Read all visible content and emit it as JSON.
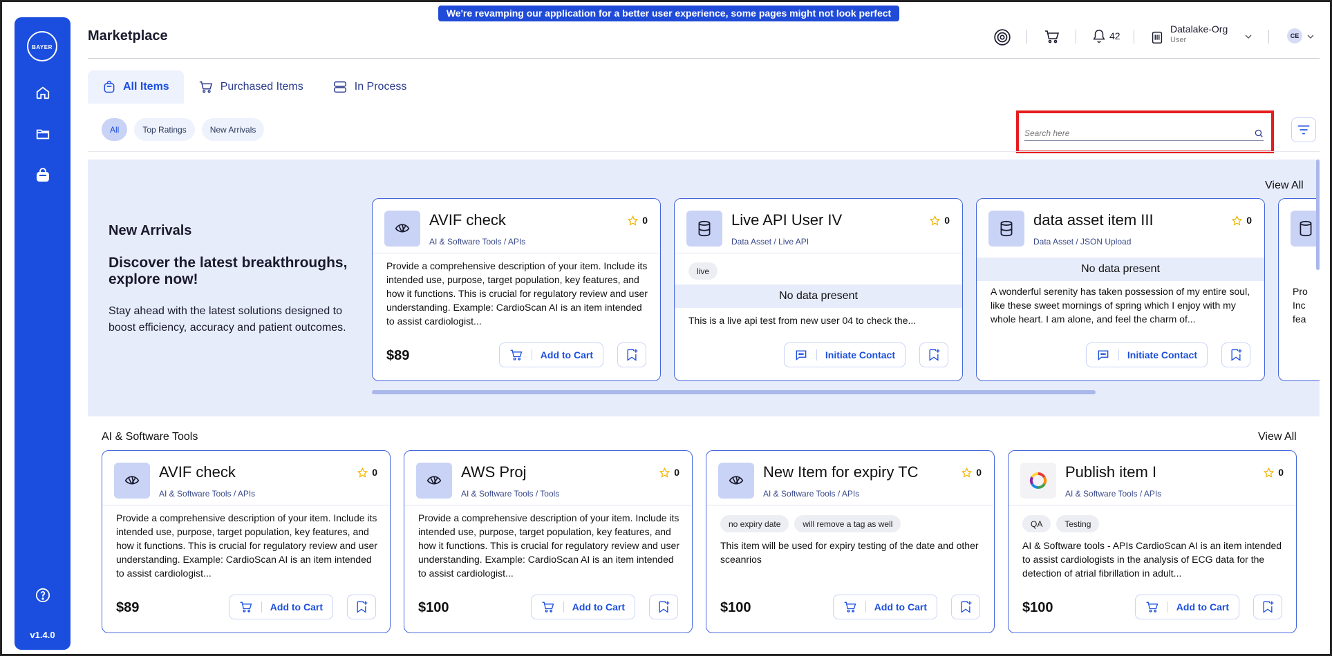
{
  "banner": "We're revamping our application for a better user experience, some pages might not look perfect yet!",
  "app": {
    "version": "v1.4.0",
    "logo_text_h": "BAYER",
    "logo_text_v": "BAYER"
  },
  "header": {
    "title": "Marketplace",
    "notification_count": "42",
    "org_name": "Datalake-Org",
    "org_role": "User",
    "avatar_initials": "CE"
  },
  "tabs": [
    {
      "label": "All Items",
      "icon": "bag-icon"
    },
    {
      "label": "Purchased Items",
      "icon": "cart-icon"
    },
    {
      "label": "In Process",
      "icon": "layers-icon"
    }
  ],
  "filters": [
    "All",
    "Top Ratings",
    "New Arrivals"
  ],
  "search": {
    "placeholder": "Search here"
  },
  "arrivals": {
    "heading": "New Arrivals",
    "subheading": "Discover the latest breakthroughs, explore now!",
    "description": "Stay ahead with the latest solutions designed to boost efficiency, accuracy and patient outcomes.",
    "view_all": "View All",
    "cards": [
      {
        "title": "AVIF check",
        "category": "AI & Software Tools / APIs",
        "rating": "0",
        "description": "Provide a comprehensive description of your item. Include its intended use, purpose, target population, key features, and how it functions. This is crucial for regulatory review and user understanding. Example: CardioScan AI is an item intended to assist cardiologist...",
        "price": "$89",
        "action": "Add to Cart"
      },
      {
        "title": "Live API User IV",
        "category": "Data Asset / Live API",
        "rating": "0",
        "tag": "live",
        "no_data": "No data present",
        "description": "This is a live api test from new user 04 to check the...",
        "action": "Initiate Contact"
      },
      {
        "title": "data asset item III",
        "category": "Data Asset / JSON Upload",
        "rating": "0",
        "no_data": "No data present",
        "description": "A wonderful serenity has taken possession of my entire soul, like these sweet mornings of spring which I enjoy with my whole heart. I am alone, and feel the charm of...",
        "action": "Initiate Contact"
      }
    ]
  },
  "ai_tools": {
    "title": "AI & Software Tools",
    "view_all": "View All",
    "cards": [
      {
        "title": "AVIF check",
        "category": "AI & Software Tools / APIs",
        "rating": "0",
        "description": "Provide a comprehensive description of your item. Include its intended use, purpose, target population, key features, and how it functions. This is crucial for regulatory review and user understanding. Example: CardioScan AI is an item intended to assist cardiologist...",
        "price": "$89",
        "action": "Add to Cart"
      },
      {
        "title": "AWS Proj",
        "category": "AI & Software Tools / Tools",
        "rating": "0",
        "description": "Provide a comprehensive description of your item. Include its intended use, purpose, target population, key features, and how it functions. This is crucial for regulatory review and user understanding. Example: CardioScan AI is an item intended to assist cardiologist...",
        "price": "$100",
        "action": "Add to Cart"
      },
      {
        "title": "New Item for expiry TC",
        "category": "AI & Software Tools / APIs",
        "rating": "0",
        "tags": [
          "no expiry date",
          "will remove a tag as well"
        ],
        "description": "This item will be used for expiry testing of the date and other sceanrios",
        "price": "$100",
        "action": "Add to Cart"
      },
      {
        "title": "Publish item I",
        "category": "AI & Software Tools / APIs",
        "rating": "0",
        "tags": [
          "QA",
          "Testing"
        ],
        "description": "AI & Software tools - APIs CardioScan AI is an item intended to assist cardiologists in the analysis of ECG data for the detection of atrial fibrillation in adult...",
        "price": "$100",
        "action": "Add to Cart"
      }
    ]
  },
  "partial_card": {
    "text": "Pro Inc fea"
  },
  "colors": {
    "primary": "#1b4ede",
    "banner": "#1f4bd8",
    "section_bg": "#e7ecfb",
    "star": "#f0b400",
    "highlight": "#e41e1e"
  }
}
